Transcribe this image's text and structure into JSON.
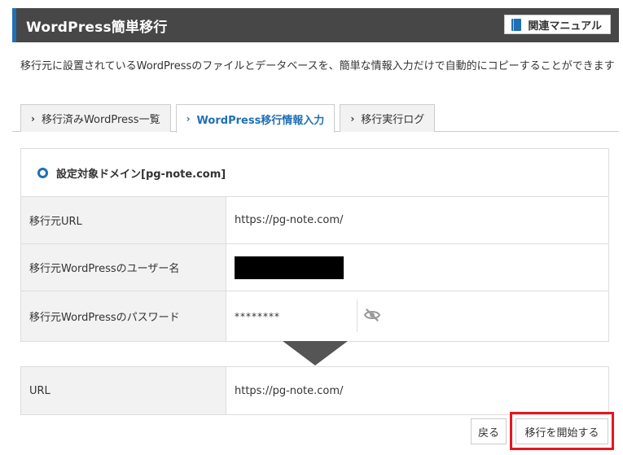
{
  "header": {
    "title": "WordPress簡単移行",
    "manual_label": "関連マニュアル",
    "accent_color": "#1f6fb5"
  },
  "description": "移行元に設置されているWordPressのファイルとデータベースを、簡単な情報入力だけで自動的にコピーすることができます",
  "tabs": [
    {
      "label": "移行済みWordPress一覧",
      "active": false
    },
    {
      "label": "WordPress移行情報入力",
      "active": true
    },
    {
      "label": "移行実行ログ",
      "active": false
    }
  ],
  "form": {
    "heading": "設定対象ドメイン[pg-note.com]",
    "rows": [
      {
        "label": "移行元URL",
        "value": "https://pg-note.com/"
      },
      {
        "label": "移行元WordPressのユーザー名",
        "value": ""
      },
      {
        "label": "移行元WordPressのパスワード",
        "value": "********"
      }
    ]
  },
  "destination": {
    "label": "URL",
    "value": "https://pg-note.com/"
  },
  "buttons": {
    "back_label": "戻る",
    "start_label": "移行を開始する",
    "highlight_color": "#e8151f"
  }
}
